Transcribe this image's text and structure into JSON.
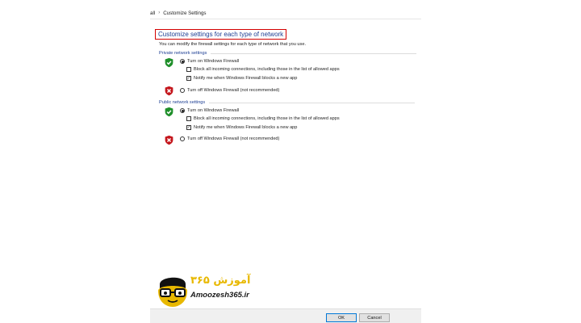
{
  "address": {
    "crumb_prev": "all",
    "separator": "›",
    "crumb_current": "Customize Settings"
  },
  "page": {
    "title": "Customize settings for each type of network",
    "description": "You can modify the firewall settings for each type of network that you use."
  },
  "private": {
    "heading": "Private network settings",
    "turn_on": "Turn on Windows Firewall",
    "turn_on_selected": true,
    "block_all": "Block all incoming connections, including those in the list of allowed apps",
    "block_all_checked": false,
    "notify": "Notify me when Windows Firewall blocks a new app",
    "notify_checked": true,
    "turn_off": "Turn off Windows Firewall (not recommended)"
  },
  "public": {
    "heading": "Public network settings",
    "turn_on": "Turn on Windows Firewall",
    "turn_on_selected": true,
    "block_all": "Block all incoming connections, including those in the list of allowed apps",
    "block_all_checked": false,
    "notify": "Notify me when Windows Firewall blocks a new app",
    "notify_checked": true,
    "turn_off": "Turn off Windows Firewall (not recommended)"
  },
  "buttons": {
    "ok": "OK",
    "cancel": "Cancel"
  },
  "logo": {
    "text_en": "Amoozesh365.ir",
    "text_fa": "آموزش ۳۶۵"
  },
  "icons": {
    "shield_ok": "green-shield-check-icon",
    "shield_off": "red-shield-x-icon"
  },
  "colors": {
    "accent": "#1e3f94",
    "highlight_border": "#d40000",
    "shield_ok": "#1f8f2a",
    "shield_off": "#c4161c",
    "logo": "#e8b800"
  }
}
